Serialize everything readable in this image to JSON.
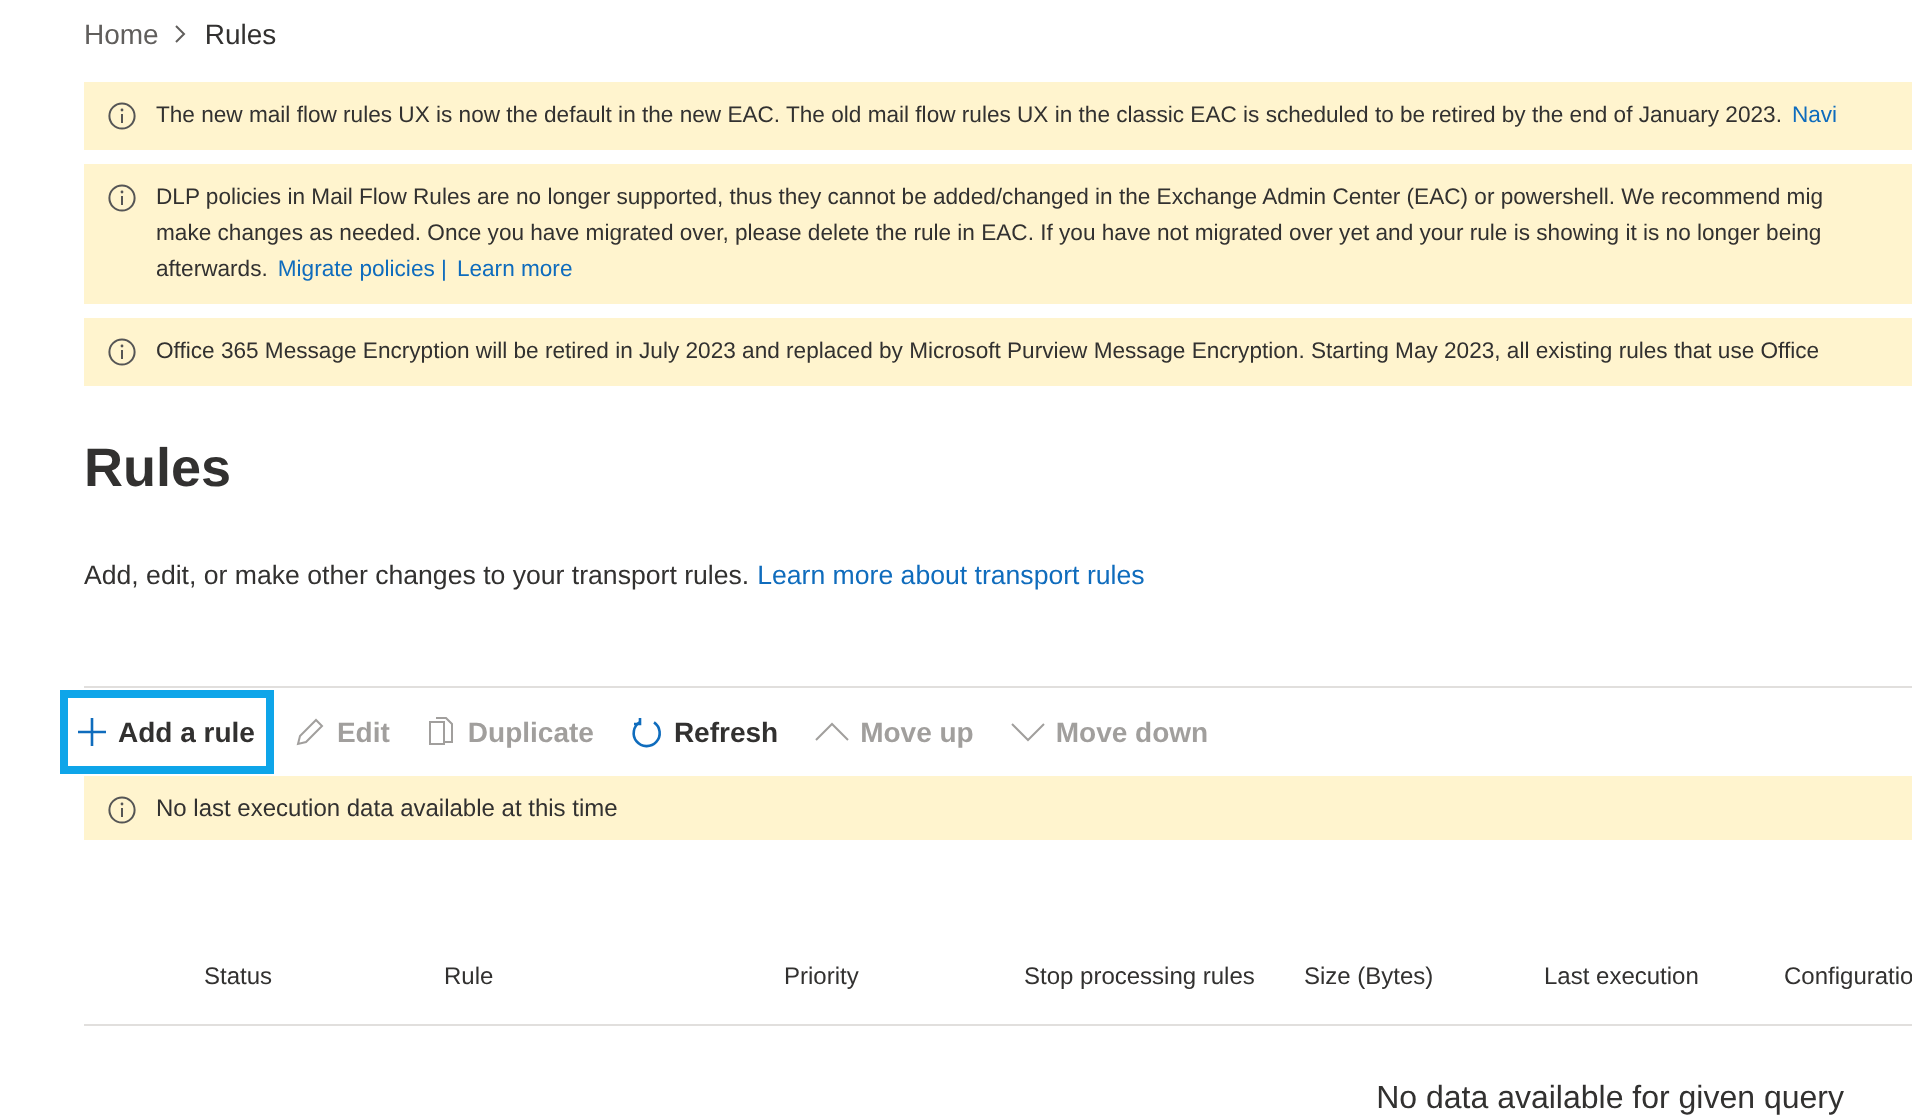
{
  "breadcrumb": [
    {
      "label": "Home"
    },
    {
      "label": "Rules"
    }
  ],
  "banners": [
    {
      "lines": [
        {
          "text": "The new mail flow rules UX is now the default in the new EAC. The old mail flow rules UX in the classic EAC is scheduled to be retired by the end of January 2023.",
          "links": [
            "Navi"
          ]
        }
      ]
    },
    {
      "lines": [
        {
          "text": "DLP policies in Mail Flow Rules are no longer supported, thus they cannot be added/changed in the Exchange Admin Center (EAC) or powershell. We recommend mig"
        },
        {
          "text": "make changes as needed. Once you have migrated over, please delete the rule in EAC. If you have not migrated over yet and your rule is showing it is no longer being"
        },
        {
          "text": "afterwards.",
          "links": [
            "Migrate policies |",
            "Learn more"
          ]
        }
      ]
    },
    {
      "lines": [
        {
          "text": "Office 365 Message Encryption will be retired in July 2023 and replaced by Microsoft Purview Message Encryption. Starting May 2023, all existing rules that use Office"
        }
      ]
    }
  ],
  "title": "Rules",
  "description": {
    "text": "Add, edit, or make other changes to your transport rules.",
    "link": "Learn more about transport rules"
  },
  "toolbar": [
    {
      "kind": "add",
      "label": "Add a rule",
      "disabled": false,
      "focused": true
    },
    {
      "kind": "edit",
      "label": "Edit",
      "disabled": true,
      "focused": false
    },
    {
      "kind": "duplicate",
      "label": "Duplicate",
      "disabled": true,
      "focused": false
    },
    {
      "kind": "refresh",
      "label": "Refresh",
      "disabled": false,
      "focused": false
    },
    {
      "kind": "up",
      "label": "Move up",
      "disabled": true,
      "focused": false
    },
    {
      "kind": "down",
      "label": "Move down",
      "disabled": true,
      "focused": false
    }
  ],
  "notice": "No last execution data available at this time",
  "table": {
    "columns": [
      "Status",
      "Rule",
      "Priority",
      "Stop processing rules",
      "Size (Bytes)",
      "Last execution",
      "Configuratio"
    ],
    "empty_message": "No data available for given query"
  }
}
